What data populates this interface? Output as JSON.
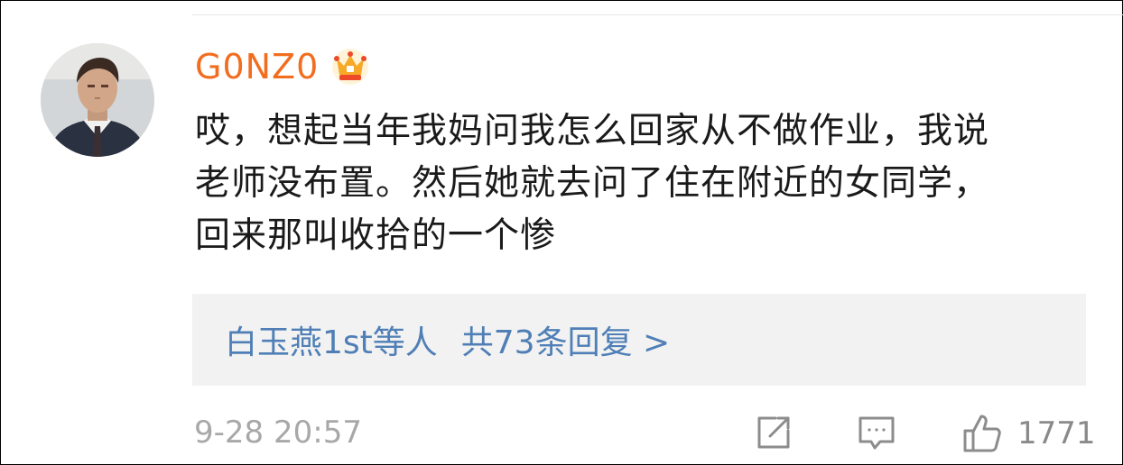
{
  "comment": {
    "username": "G0NZ0",
    "user_badge_icon": "vip-crown-icon",
    "lines": [
      "哎，想起当年我妈问我怎么回家从不做作业，我说",
      "老师没布置。然后她就去问了住在附近的女同学，",
      "回来那叫收拾的一个惨"
    ],
    "replies": {
      "users_label": "白玉燕1st等人",
      "count_label": "共73条回复 >"
    },
    "timestamp": "9-28 20:57",
    "actions": {
      "share_icon": "share-icon",
      "comment_icon": "comment-icon",
      "like_icon": "thumbs-up-icon",
      "like_count": "1771"
    }
  },
  "colors": {
    "username": "#f26d1f",
    "link": "#4f7fb6",
    "reply_bg": "#f2f2f2",
    "meta_text": "#a8a8a8"
  }
}
